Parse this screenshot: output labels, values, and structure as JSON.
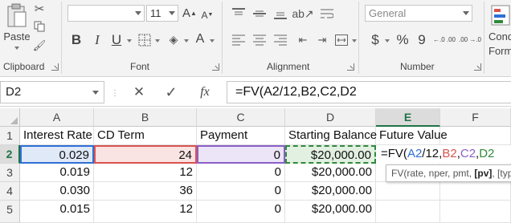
{
  "ribbon": {
    "clipboard": {
      "paste_label": "Paste",
      "group_label": "Clipboard"
    },
    "font": {
      "font_size": "11",
      "group_label": "Font",
      "bold": "B",
      "italic": "I",
      "underline": "U"
    },
    "alignment": {
      "group_label": "Alignment"
    },
    "number": {
      "format": "General",
      "group_label": "Number",
      "currency": "$",
      "percent": "%",
      "comma": "9",
      "inc_decimals": "←.0 .00",
      "dec_decimals": ".00 →.0"
    },
    "styles": {
      "cond_label_line1": "Cond",
      "cond_label_line2": "Forma"
    }
  },
  "formula_bar": {
    "name_box": "D2",
    "cancel": "✕",
    "enter": "✓",
    "fx": "fx",
    "formula": "=FV(A2/12,B2,C2,D2"
  },
  "grid": {
    "columns": [
      "A",
      "B",
      "C",
      "D",
      "E",
      "F"
    ],
    "rows": [
      "1",
      "2",
      "3",
      "4",
      "5"
    ],
    "headers": [
      "Interest Rate",
      "CD Term",
      "Payment",
      "Starting Balance",
      "Future Value"
    ],
    "data": [
      {
        "rate": "0.029",
        "term": "24",
        "payment": "0",
        "balance": "$20,000.00"
      },
      {
        "rate": "0.019",
        "term": "12",
        "payment": "0",
        "balance": "$20,000.00"
      },
      {
        "rate": "0.030",
        "term": "36",
        "payment": "0",
        "balance": "$20,000.00"
      },
      {
        "rate": "0.015",
        "term": "12",
        "payment": "0",
        "balance": "$20,000.00"
      }
    ],
    "edit_cell": {
      "prefix": "=FV(",
      "ref_a": "A2",
      "part_div": "/12,",
      "ref_b": "B2",
      "comma1": ",",
      "ref_c": "C2",
      "comma2": ",",
      "ref_d": "D2"
    },
    "tooltip": {
      "func": "FV(rate, nper, pmt, ",
      "bold_arg": "[pv]",
      "rest": ", [type])"
    },
    "colors": {
      "ref_a": "#2f6fd6",
      "ref_b": "#d9534f",
      "ref_c": "#8a5fc8",
      "ref_d": "#2f8a3c",
      "active": "#217346"
    }
  }
}
